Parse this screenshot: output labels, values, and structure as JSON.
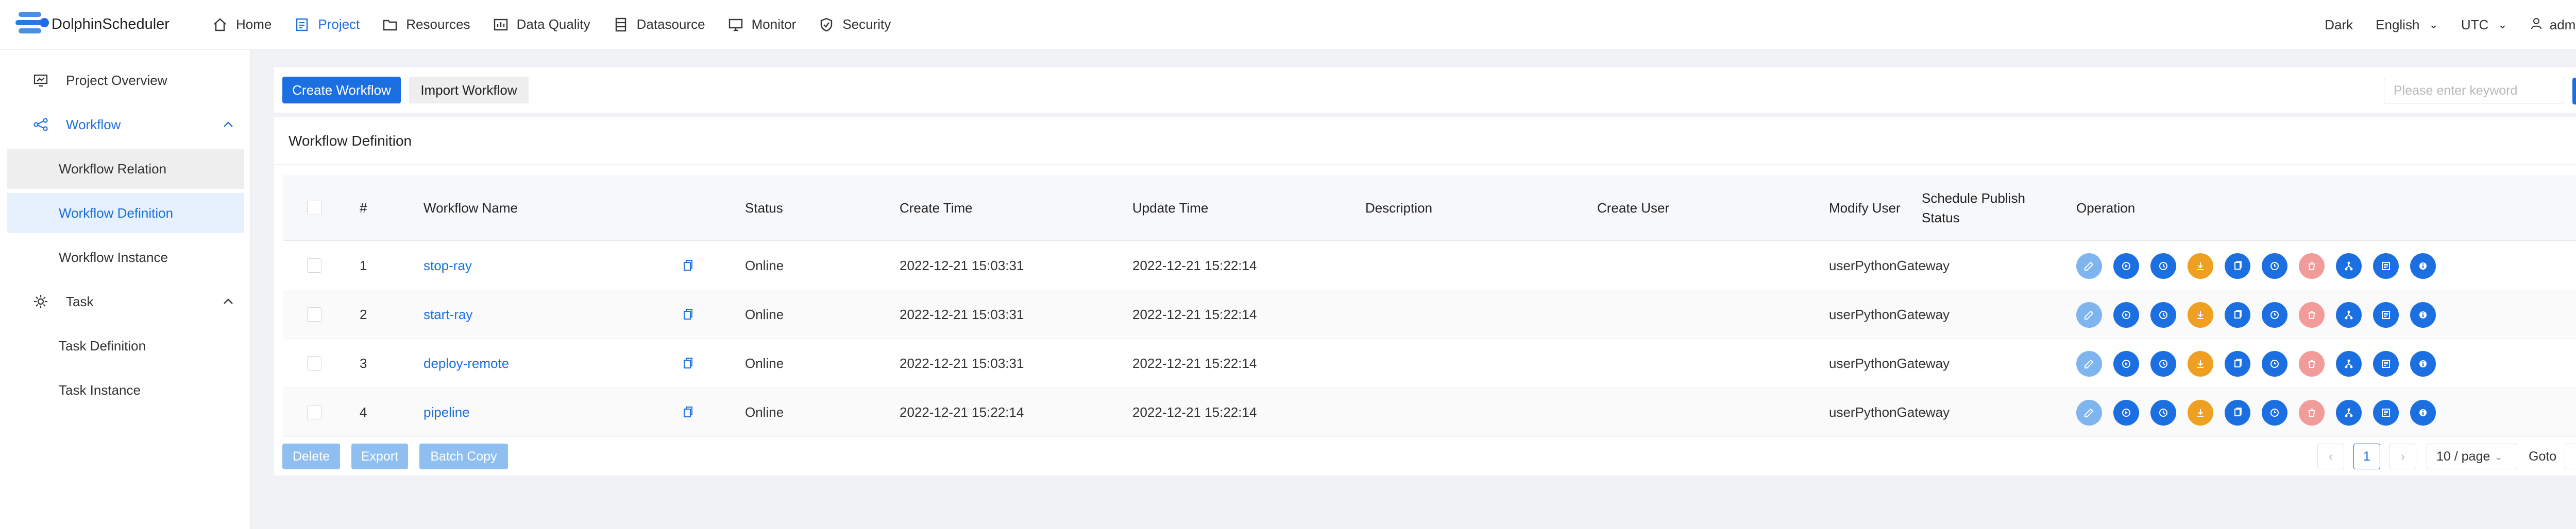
{
  "app": {
    "title": "DolphinScheduler"
  },
  "header": {
    "nav": [
      {
        "label": "Home",
        "icon": "home-icon"
      },
      {
        "label": "Project",
        "icon": "project-icon",
        "active": true
      },
      {
        "label": "Resources",
        "icon": "folder-icon"
      },
      {
        "label": "Data Quality",
        "icon": "data-quality-icon"
      },
      {
        "label": "Datasource",
        "icon": "database-icon"
      },
      {
        "label": "Monitor",
        "icon": "monitor-icon"
      },
      {
        "label": "Security",
        "icon": "shield-icon"
      }
    ],
    "theme": "Dark",
    "language": "English",
    "timezone": "UTC",
    "user": "admin"
  },
  "sidebar": {
    "project_overview": "Project Overview",
    "workflow": "Workflow",
    "workflow_relation": "Workflow Relation",
    "workflow_definition": "Workflow Definition",
    "workflow_instance": "Workflow Instance",
    "task": "Task",
    "task_definition": "Task Definition",
    "task_instance": "Task Instance"
  },
  "toolbar": {
    "create_label": "Create Workflow",
    "import_label": "Import Workflow",
    "search_placeholder": "Please enter keyword"
  },
  "table": {
    "title": "Workflow Definition",
    "columns": {
      "index": "#",
      "name": "Workflow Name",
      "status": "Status",
      "create_time": "Create Time",
      "update_time": "Update Time",
      "description": "Description",
      "create_user": "Create User",
      "modify_user": "Modify User",
      "schedule_status": "Schedule Publish Status",
      "operation": "Operation"
    },
    "rows": [
      {
        "index": "1",
        "name": "stop-ray",
        "status": "Online",
        "create_time": "2022-12-21 15:03:31",
        "update_time": "2022-12-21 15:22:14",
        "description": "",
        "create_user": "",
        "modify_user": "userPythonGateway",
        "schedule_status": "-"
      },
      {
        "index": "2",
        "name": "start-ray",
        "status": "Online",
        "create_time": "2022-12-21 15:03:31",
        "update_time": "2022-12-21 15:22:14",
        "description": "",
        "create_user": "",
        "modify_user": "userPythonGateway",
        "schedule_status": "-"
      },
      {
        "index": "3",
        "name": "deploy-remote",
        "status": "Online",
        "create_time": "2022-12-21 15:03:31",
        "update_time": "2022-12-21 15:22:14",
        "description": "",
        "create_user": "",
        "modify_user": "userPythonGateway",
        "schedule_status": "-"
      },
      {
        "index": "4",
        "name": "pipeline",
        "status": "Online",
        "create_time": "2022-12-21 15:22:14",
        "update_time": "2022-12-21 15:22:14",
        "description": "",
        "create_user": "",
        "modify_user": "userPythonGateway",
        "schedule_status": "-"
      }
    ],
    "operations": [
      {
        "icon": "edit-icon",
        "color": "#7fb5ee"
      },
      {
        "icon": "run-icon",
        "color": "#1c6fe0"
      },
      {
        "icon": "timing-icon",
        "color": "#1c6fe0"
      },
      {
        "icon": "offline-icon",
        "color": "#f0a020"
      },
      {
        "icon": "copy-icon",
        "color": "#1c6fe0"
      },
      {
        "icon": "cron-manage-icon",
        "color": "#1c6fe0"
      },
      {
        "icon": "delete-icon",
        "color": "#f29b9b"
      },
      {
        "icon": "tree-view-icon",
        "color": "#1c6fe0"
      },
      {
        "icon": "version-info-icon",
        "color": "#1c6fe0"
      },
      {
        "icon": "info-icon",
        "color": "#1c6fe0"
      }
    ]
  },
  "footer": {
    "delete_label": "Delete",
    "export_label": "Export",
    "batch_copy_label": "Batch Copy",
    "current_page": "1",
    "page_size": "10 / page",
    "goto_label": "Goto"
  },
  "colors": {
    "primary": "#1c6fe0",
    "warning": "#f0a020",
    "danger": "#f29b9b",
    "disabled": "#7fb5ee"
  }
}
